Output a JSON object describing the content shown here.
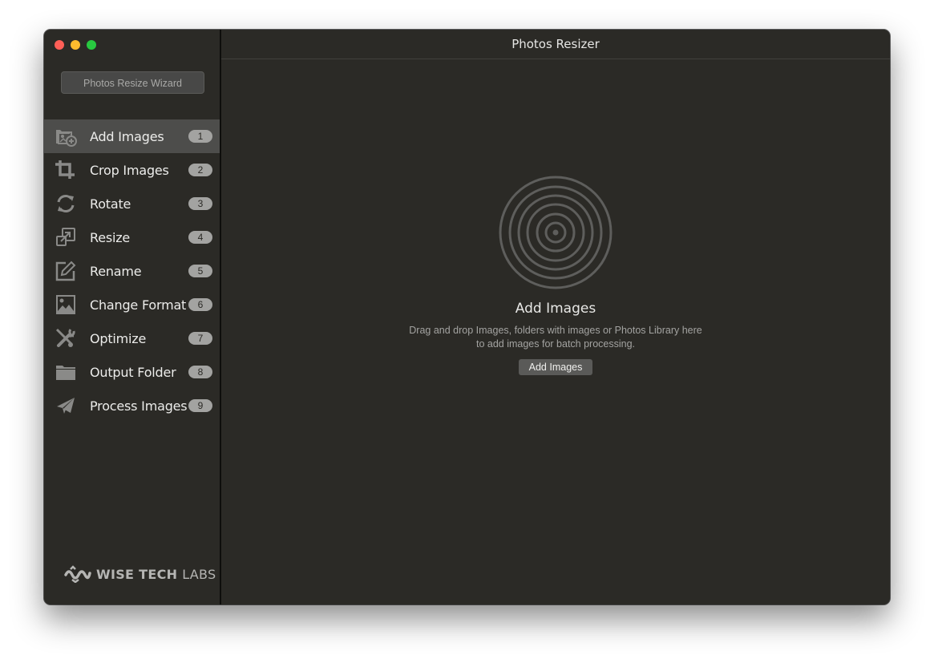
{
  "window": {
    "title": "Photos Resizer"
  },
  "sidebar": {
    "wizard_button": "Photos Resize Wizard",
    "items": [
      {
        "label": "Add Images",
        "badge": "1",
        "icon": "add-images-icon",
        "active": true
      },
      {
        "label": "Crop Images",
        "badge": "2",
        "icon": "crop-icon",
        "active": false
      },
      {
        "label": "Rotate",
        "badge": "3",
        "icon": "rotate-icon",
        "active": false
      },
      {
        "label": "Resize",
        "badge": "4",
        "icon": "resize-icon",
        "active": false
      },
      {
        "label": "Rename",
        "badge": "5",
        "icon": "rename-icon",
        "active": false
      },
      {
        "label": "Change Format",
        "badge": "6",
        "icon": "image-format-icon",
        "active": false
      },
      {
        "label": "Optimize",
        "badge": "7",
        "icon": "tools-icon",
        "active": false
      },
      {
        "label": "Output Folder",
        "badge": "8",
        "icon": "folder-icon",
        "active": false
      },
      {
        "label": "Process Images",
        "badge": "9",
        "icon": "paper-plane-icon",
        "active": false
      }
    ],
    "logo": {
      "bold": "WISE TECH",
      "light": "LABS"
    }
  },
  "main": {
    "drop_title": "Add Images",
    "drop_desc_line1": "Drag and drop Images, folders with images or Photos Library here",
    "drop_desc_line2": "to add images for batch processing.",
    "add_button": "Add Images"
  }
}
